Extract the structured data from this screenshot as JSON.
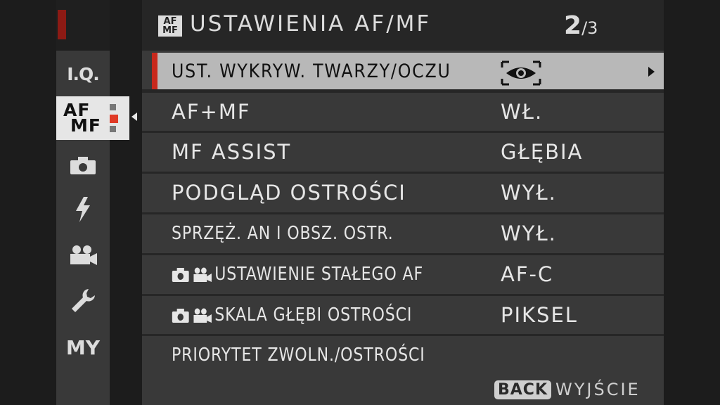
{
  "header": {
    "icon_top": "AF",
    "icon_bottom": "MF",
    "title": "USTAWIENIA AF/MF",
    "page_current": "2",
    "page_total": "/3"
  },
  "sidebar": {
    "items": [
      {
        "label": "I.Q.",
        "icon": "image-quality-icon"
      },
      {
        "label_top": "AF",
        "label_bottom": "MF",
        "icon": "af-mf-icon",
        "active": true
      },
      {
        "label": "",
        "icon": "camera-icon"
      },
      {
        "label": "",
        "icon": "flash-icon"
      },
      {
        "label": "",
        "icon": "movie-icon"
      },
      {
        "label": "",
        "icon": "wrench-icon"
      },
      {
        "label": "MY",
        "icon": "my-menu-icon"
      }
    ]
  },
  "menu": {
    "rows": [
      {
        "label": "UST. WYKRYW. TWARZY/OCZU",
        "value": "",
        "value_icon": "eye-detection-icon",
        "selected": true
      },
      {
        "label": "AF+MF",
        "value": "WŁ."
      },
      {
        "label": "MF ASSIST",
        "value": "GŁĘBIA"
      },
      {
        "label": "PODGLĄD OSTROŚCI",
        "value": "WYŁ."
      },
      {
        "label": "SPRZĘŻ. AN I OBSZ. OSTR.",
        "value": "WYŁ."
      },
      {
        "label": "USTAWIENIE STAŁEGO AF",
        "value": "AF-C",
        "prefix_icons": [
          "camera-icon",
          "movie-icon"
        ]
      },
      {
        "label": "SKALA GŁĘBI OSTROŚCI",
        "value": "PIKSEL",
        "prefix_icons": [
          "camera-icon",
          "movie-icon"
        ]
      },
      {
        "label": "PRIORYTET ZWOLN./OSTROŚCI",
        "value": ""
      }
    ]
  },
  "footer": {
    "back_label": "BACK",
    "exit_label": "WYJŚCIE"
  },
  "colors": {
    "accent_red": "#c8281c",
    "selected_row": "#b8b8b8",
    "row_bg": "#393939"
  }
}
